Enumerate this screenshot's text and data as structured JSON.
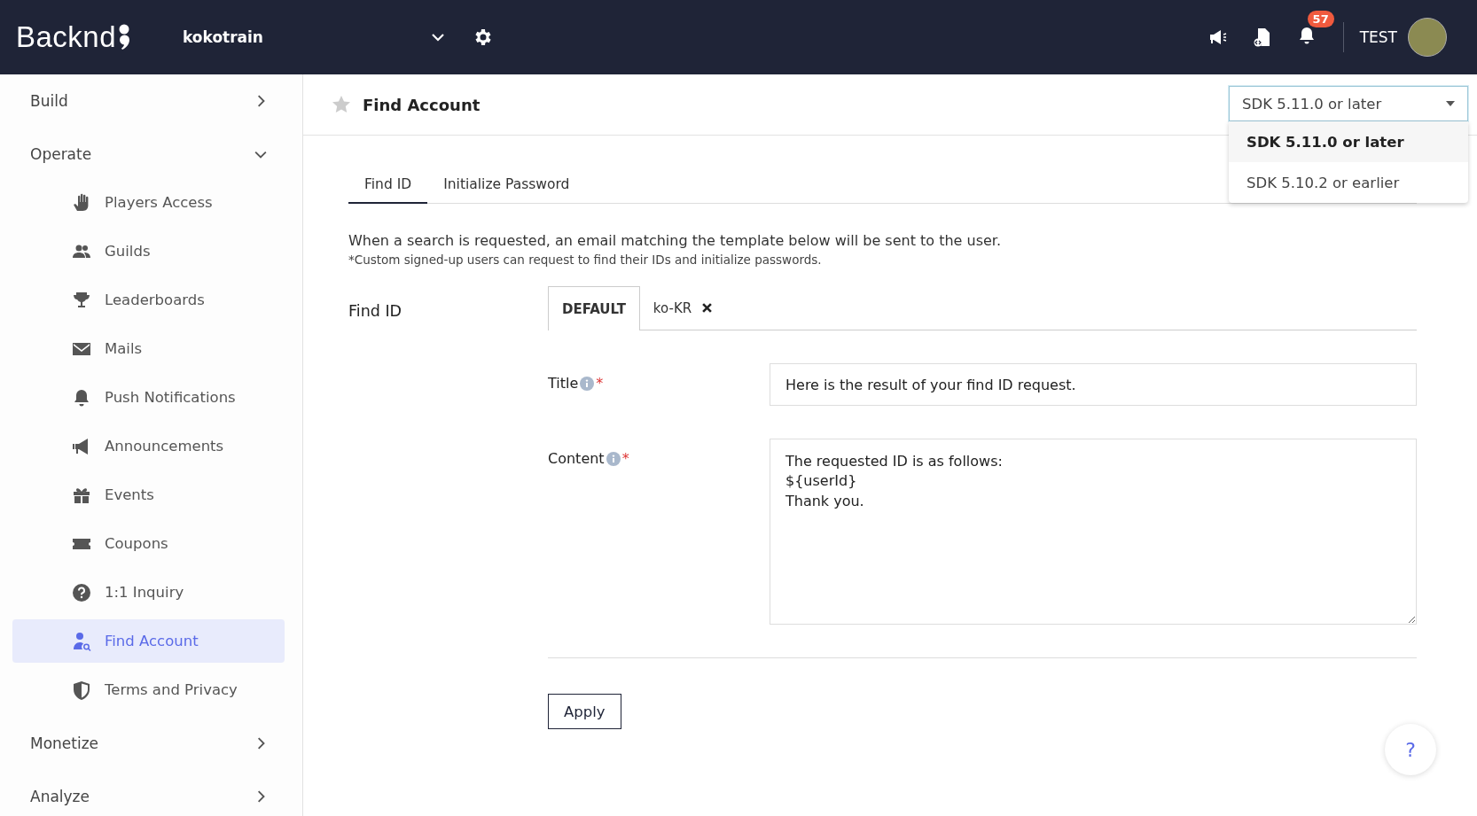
{
  "topbar": {
    "logo": "Backnd",
    "project": "kokotrain",
    "notification_count": "57",
    "user": "TEST"
  },
  "sidebar": {
    "groups": [
      {
        "label": "Build",
        "expanded": false
      },
      {
        "label": "Operate",
        "expanded": true,
        "children": [
          {
            "label": "Players Access",
            "selected": false
          },
          {
            "label": "Guilds",
            "selected": false
          },
          {
            "label": "Leaderboards",
            "selected": false
          },
          {
            "label": "Mails",
            "selected": false
          },
          {
            "label": "Push Notifications",
            "selected": false
          },
          {
            "label": "Announcements",
            "selected": false
          },
          {
            "label": "Events",
            "selected": false
          },
          {
            "label": "Coupons",
            "selected": false
          },
          {
            "label": "1:1 Inquiry",
            "selected": false
          },
          {
            "label": "Find Account",
            "selected": true
          },
          {
            "label": "Terms and Privacy",
            "selected": false
          }
        ]
      },
      {
        "label": "Monetize",
        "expanded": false
      },
      {
        "label": "Analyze",
        "expanded": false
      }
    ]
  },
  "page": {
    "title": "Find Account",
    "favorite": false,
    "sdk_select": {
      "value": "SDK 5.11.0 or later",
      "expanded": true,
      "options": [
        {
          "label": "SDK 5.11.0 or later",
          "selected": true
        },
        {
          "label": "SDK 5.10.2 or earlier",
          "selected": false
        }
      ]
    },
    "tabs": [
      {
        "label": "Find ID",
        "selected": true
      },
      {
        "label": "Initialize Password",
        "selected": false
      }
    ],
    "description": "When a search is requested, an email matching the template below will be sent to the user.",
    "note": "*Custom signed-up users can request to find their IDs and initialize passwords.",
    "section_label": "Find ID",
    "language_tabs": [
      {
        "label": "DEFAULT",
        "selected": true,
        "removable": false
      },
      {
        "label": "ko-KR",
        "selected": false,
        "removable": true
      }
    ],
    "fields": [
      {
        "kind": "input",
        "label": "Title",
        "required_mark": "*",
        "value": "Here is the result of your find ID request."
      },
      {
        "kind": "textarea",
        "label": "Content",
        "required_mark": "*",
        "value": "The requested ID is as follows:\n${userId}\nThank you."
      }
    ],
    "apply_button": "Apply",
    "help_button": "?"
  }
}
